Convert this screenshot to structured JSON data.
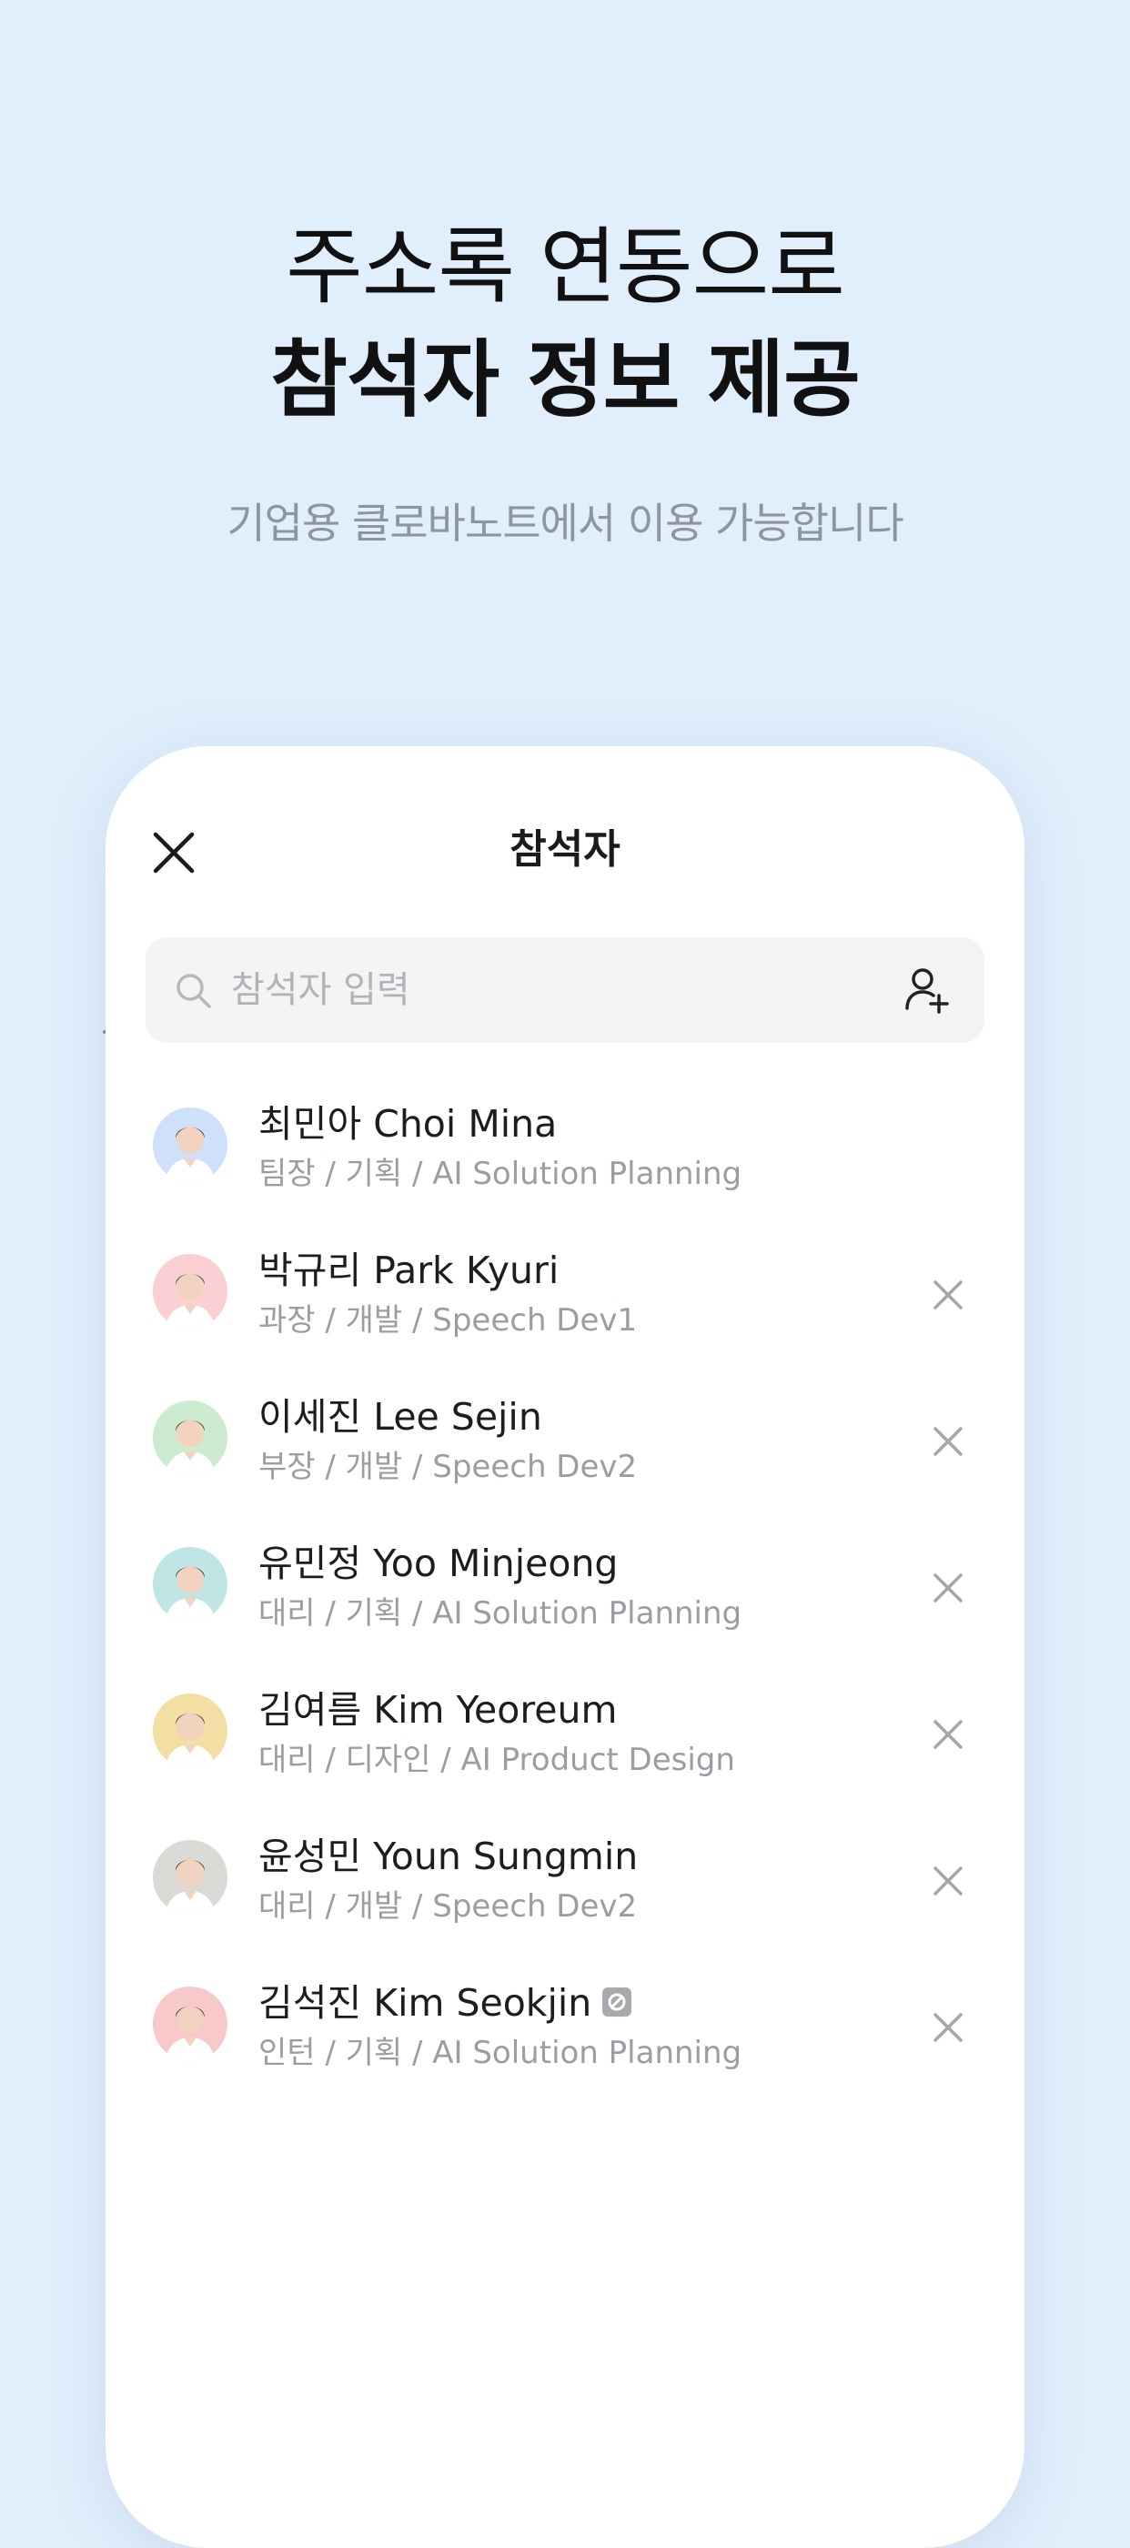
{
  "headline": {
    "line1": "주소록 연동으로",
    "line2": "참석자 정보 제공"
  },
  "subtitle": "기업용 클로바노트에서 이용 가능합니다",
  "sheet": {
    "title": "참석자",
    "close_icon": "close-icon",
    "search": {
      "placeholder": "참석자 입력",
      "value": "",
      "icon": "search-icon",
      "action_icon": "add-person-icon"
    },
    "participants": [
      {
        "name": "최민아 Choi Mina",
        "detail": "팀장 / 기획 / AI Solution Planning",
        "avatar_bg": "#cfe0fb",
        "removable": false,
        "badge": false
      },
      {
        "name": "박규리 Park Kyuri",
        "detail": "과장 / 개발 / Speech Dev1",
        "avatar_bg": "#fbd0d2",
        "removable": true,
        "badge": false
      },
      {
        "name": "이세진 Lee Sejin",
        "detail": "부장 / 개발 / Speech Dev2",
        "avatar_bg": "#cdeccf",
        "removable": true,
        "badge": false
      },
      {
        "name": "유민정 Yoo Minjeong",
        "detail": "대리 / 기획 / AI Solution Planning",
        "avatar_bg": "#bfe6e4",
        "removable": true,
        "badge": false
      },
      {
        "name": "김여름 Kim Yeoreum",
        "detail": "대리 / 디자인 / AI Product Design",
        "avatar_bg": "#f3dfa4",
        "removable": true,
        "badge": false
      },
      {
        "name": "윤성민 Youn Sungmin",
        "detail": "대리 / 개발 / Speech Dev2",
        "avatar_bg": "#dcdad6",
        "removable": true,
        "badge": false
      },
      {
        "name": "김석진 Kim Seokjin",
        "detail": "인턴 / 기획 / AI Solution Planning",
        "avatar_bg": "#f8c9c9",
        "removable": true,
        "badge": true
      }
    ],
    "remove_icon": "remove-icon",
    "badge_icon": "blocked-badge-icon"
  },
  "colors": {
    "background": "#e1effc",
    "card": "#ffffff",
    "search_bg": "#f4f4f5",
    "secondary_text": "#9a9ea3"
  }
}
